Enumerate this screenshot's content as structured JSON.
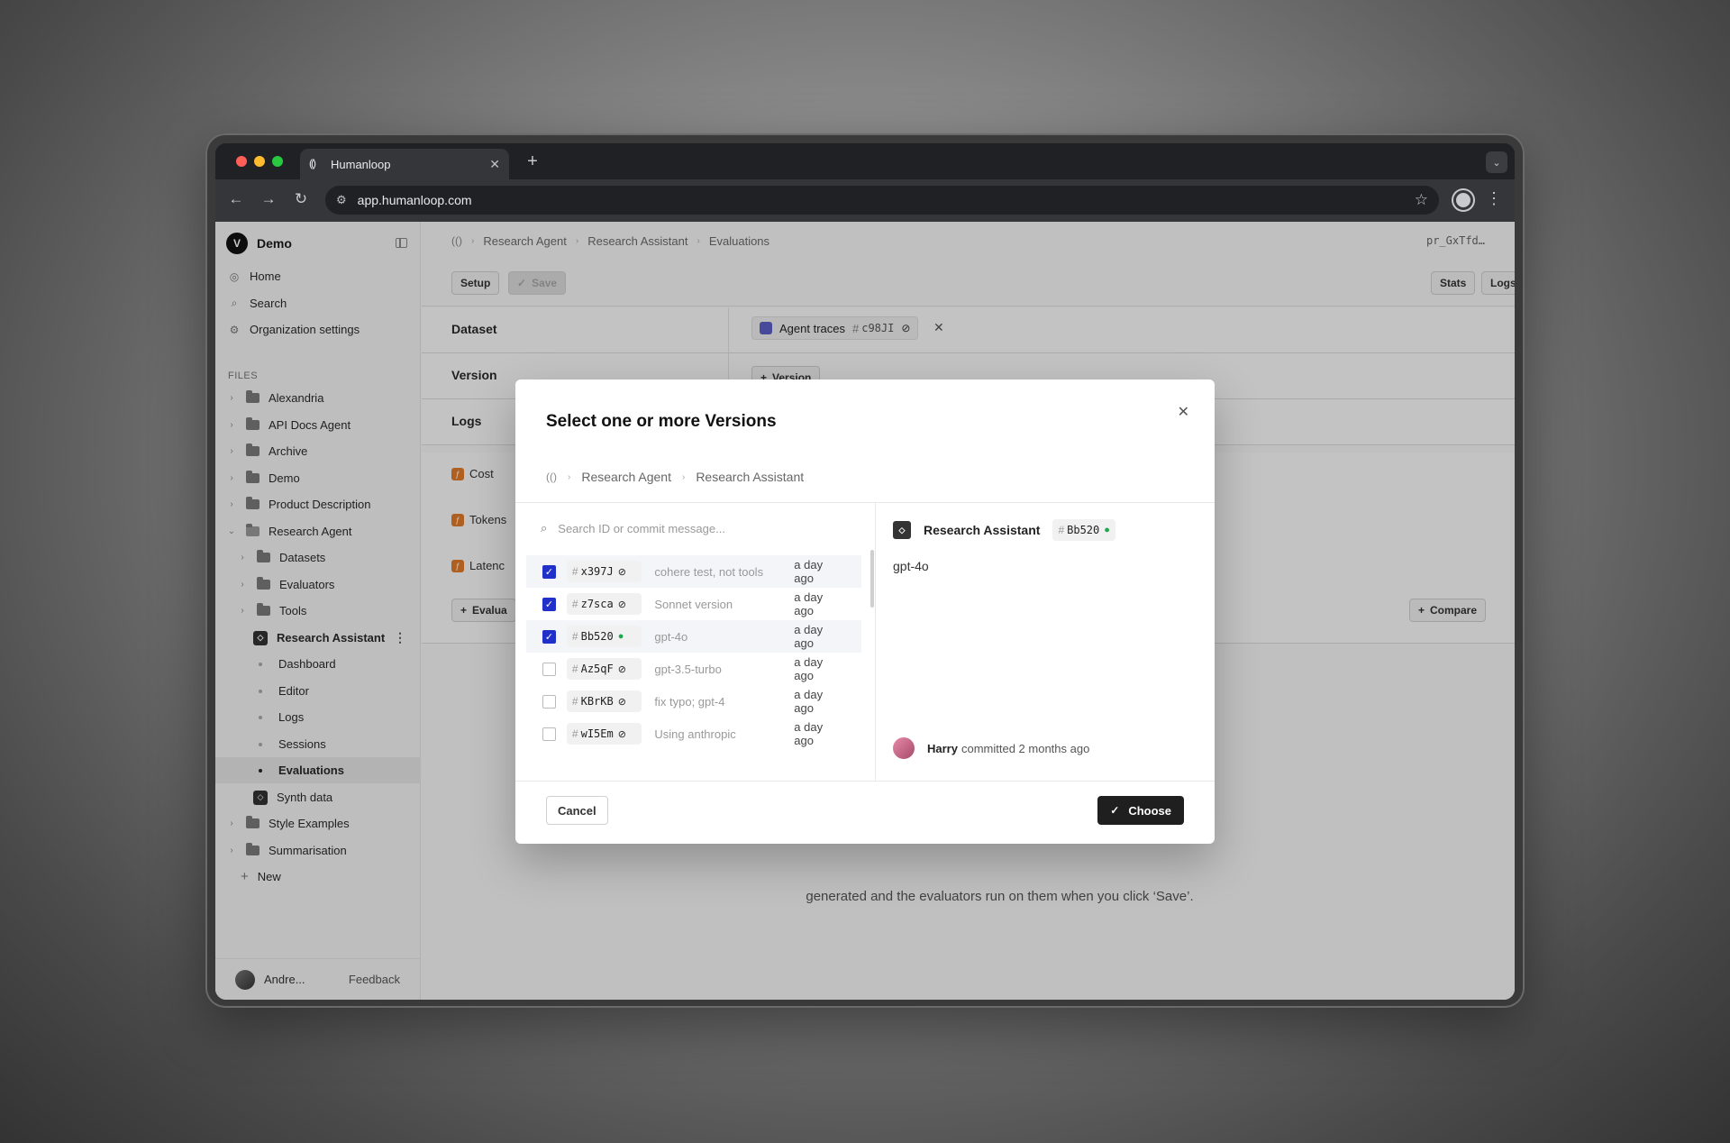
{
  "browser": {
    "tab_title": "Humanloop",
    "url": "app.humanloop.com"
  },
  "sidebar": {
    "org_name": "Demo",
    "nav": [
      {
        "label": "Home",
        "icon": "humanloop-icon"
      },
      {
        "label": "Search",
        "icon": "search-icon"
      },
      {
        "label": "Organization settings",
        "icon": "gear-icon"
      }
    ],
    "files_label": "FILES",
    "tree": [
      {
        "label": "Alexandria",
        "type": "folder"
      },
      {
        "label": "API Docs Agent",
        "type": "folder"
      },
      {
        "label": "Archive",
        "type": "folder"
      },
      {
        "label": "Demo",
        "type": "folder"
      },
      {
        "label": "Product Description",
        "type": "folder"
      },
      {
        "label": "Research Agent",
        "type": "folder-open"
      },
      {
        "label": "Datasets",
        "type": "subfolder"
      },
      {
        "label": "Evaluators",
        "type": "subfolder"
      },
      {
        "label": "Tools",
        "type": "subfolder"
      },
      {
        "label": "Research Assistant",
        "type": "file"
      },
      {
        "label": "Dashboard",
        "type": "subpage"
      },
      {
        "label": "Editor",
        "type": "subpage"
      },
      {
        "label": "Logs",
        "type": "subpage"
      },
      {
        "label": "Sessions",
        "type": "subpage"
      },
      {
        "label": "Evaluations",
        "type": "subpage-active"
      },
      {
        "label": "Synth data",
        "type": "file"
      },
      {
        "label": "Style Examples",
        "type": "folder"
      },
      {
        "label": "Summarisation",
        "type": "folder"
      },
      {
        "label": "New",
        "type": "new"
      }
    ],
    "user_name": "Andre...",
    "feedback_label": "Feedback"
  },
  "main": {
    "breadcrumb": [
      "Research Agent",
      "Research Assistant",
      "Evaluations"
    ],
    "id_text": "pr_GxTfd…",
    "setup_label": "Setup",
    "save_label": "Save",
    "stats_label": "Stats",
    "logs_label": "Logs",
    "rows": {
      "dataset_label": "Dataset",
      "version_label": "Version",
      "logs_label": "Logs"
    },
    "dataset_chip": {
      "name": "Agent traces",
      "hash": "c98JI"
    },
    "version_button": "Version",
    "evaluators": [
      "Cost",
      "Tokens",
      "Latenc"
    ],
    "add_evaluator_label": "Evalua",
    "compare_label": "Compare",
    "empty_text": "generated and the evaluators run on them when you click ‘Save’."
  },
  "modal": {
    "title": "Select one or more Versions",
    "breadcrumb": [
      "Research Agent",
      "Research Assistant"
    ],
    "search_placeholder": "Search ID or commit message...",
    "versions": [
      {
        "id": "x397J",
        "message": "cohere test, not tools",
        "time": "a day ago",
        "checked": true,
        "deployed": false
      },
      {
        "id": "z7sca",
        "message": "Sonnet version",
        "time": "a day ago",
        "checked": true,
        "deployed": false
      },
      {
        "id": "Bb520",
        "message": "gpt-4o",
        "time": "a day ago",
        "checked": true,
        "deployed": true
      },
      {
        "id": "Az5qF",
        "message": "gpt-3.5-turbo",
        "time": "a day ago",
        "checked": false,
        "deployed": false
      },
      {
        "id": "KBrKB",
        "message": "fix typo; gpt-4",
        "time": "a day ago",
        "checked": false,
        "deployed": false
      },
      {
        "id": "wI5Em",
        "message": "Using anthropic",
        "time": "a day ago",
        "checked": false,
        "deployed": false
      }
    ],
    "detail": {
      "name": "Research Assistant",
      "version": "Bb520",
      "message": "gpt-4o",
      "author": "Harry",
      "committed": "committed 2 months ago"
    },
    "cancel_label": "Cancel",
    "choose_label": "Choose"
  }
}
